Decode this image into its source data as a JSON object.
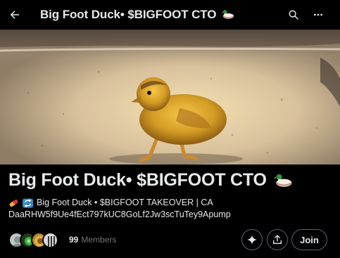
{
  "header": {
    "title": "Big Foot Duck• $BIGFOOT CTO",
    "back_icon": "arrow-left-icon",
    "search_icon": "search-icon",
    "more_icon": "more-horizontal-icon"
  },
  "community": {
    "name": "Big Foot Duck• $BIGFOOT CTO",
    "description_line1": "Big Foot Duck • $BIGFOOT TAKEOVER | CA",
    "description_line2": "DaaRHW5f9Ue4fEct797kUC8GoLf2Jw3scTuTey9Apump",
    "member_count": "99",
    "member_label": "Members"
  },
  "actions": {
    "grok_icon": "sparkle-icon",
    "share_icon": "share-icon",
    "join_label": "Join"
  },
  "colors": {
    "background": "#000000",
    "text": "#e7e9ea",
    "muted": "#71767b",
    "border": "#536471"
  }
}
